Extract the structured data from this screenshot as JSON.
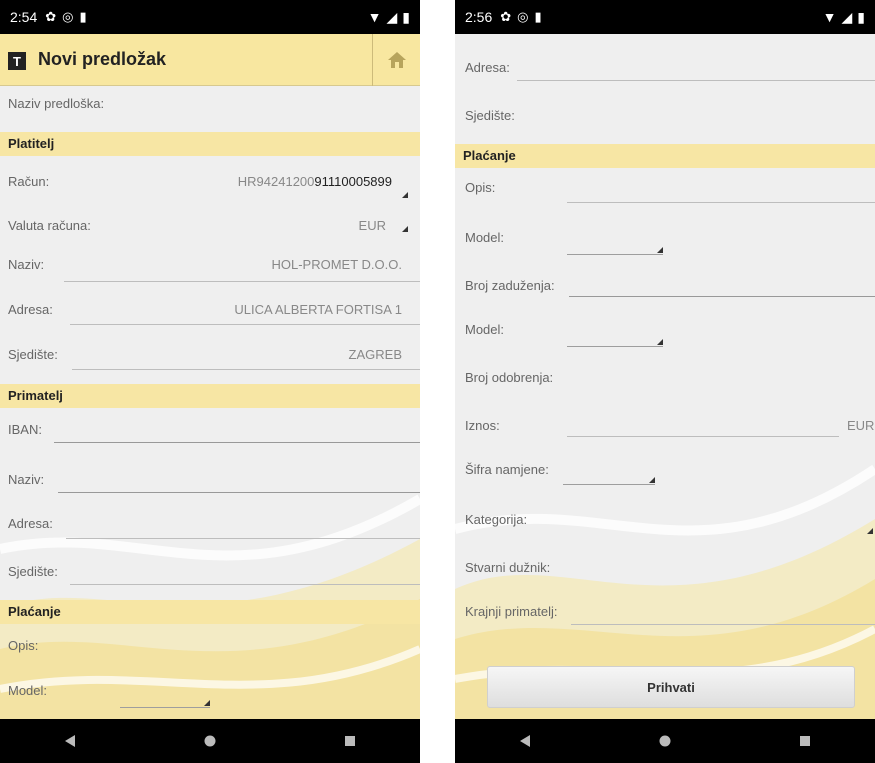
{
  "left": {
    "status": {
      "time": "2:54"
    },
    "appbar": {
      "logo": "T",
      "title": "Novi predložak"
    },
    "fields": {
      "naziv_predloska": "Naziv predloška:",
      "platitelj_section": "Platitelj",
      "racun_label": "Račun:",
      "racun_prefix": "HR94241200",
      "racun_rest": "91110005899",
      "valuta_label": "Valuta računa:",
      "valuta_value": "EUR",
      "naziv_label": "Naziv:",
      "naziv_value": "HOL-PROMET D.O.O.",
      "adresa_label": "Adresa:",
      "adresa_value": "ULICA ALBERTA FORTISA 1",
      "sjediste_label": "Sjedište:",
      "sjediste_value": "ZAGREB",
      "primatelj_section": "Primatelj",
      "iban_label": "IBAN:",
      "p_naziv_label": "Naziv:",
      "p_adresa_label": "Adresa:",
      "p_sjediste_label": "Sjedište:",
      "placanje_section": "Plaćanje",
      "opis_label": "Opis:",
      "model_label": "Model:"
    }
  },
  "right": {
    "status": {
      "time": "2:56"
    },
    "fields": {
      "adresa_label": "Adresa:",
      "sjediste_label": "Sjedište:",
      "placanje_section": "Plaćanje",
      "opis_label": "Opis:",
      "model1_label": "Model:",
      "broj_zaduzenja_label": "Broj zaduženja:",
      "model2_label": "Model:",
      "broj_odobrenja_label": "Broj odobrenja:",
      "iznos_label": "Iznos:",
      "iznos_currency": "EUR",
      "sifra_namjene_label": "Šifra namjene:",
      "kategorija_label": "Kategorija:",
      "stvarni_duznik_label": "Stvarni dužnik:",
      "krajnji_primatelj_label": "Krajnji primatelj:"
    },
    "accept_label": "Prihvati"
  },
  "icons": {
    "status": [
      "gear-icon",
      "record-icon",
      "sd-card-icon",
      "wifi-icon",
      "signal-icon",
      "battery-icon"
    ],
    "appbar": [
      "app-logo-icon",
      "home-icon"
    ],
    "nav": [
      "back-icon",
      "home-circle-icon",
      "recents-icon"
    ]
  },
  "colors": {
    "section_bg": "#f7e6a4",
    "appbar_bg": "#f8e7a0",
    "screen_bg": "#efefef"
  }
}
